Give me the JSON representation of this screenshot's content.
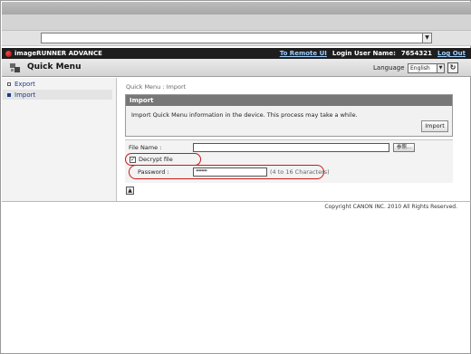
{
  "address_bar": {
    "dropdown_glyph": "▼"
  },
  "header": {
    "logo_text": "imageRUNNER ADVANCE",
    "remote_ui_link": "To Remote UI",
    "login_label": "Login User Name:",
    "user_name": "7654321",
    "logout_link": "Log Out"
  },
  "title_bar": {
    "title": "Quick Menu",
    "icon": "quick-menu-icon",
    "language_label": "Language",
    "language_value": "English",
    "refresh_icon": "refresh-icon"
  },
  "sidebar": {
    "items": [
      {
        "label": "Export",
        "active": false
      },
      {
        "label": "Import",
        "active": true
      }
    ]
  },
  "main": {
    "breadcrumb": "Quick Menu : Import",
    "panel_title": "Import",
    "panel_desc": "Import Quick Menu information in the device. This process may take a while.",
    "import_button": "Import",
    "file_name_label": "File Name :",
    "browse_button": "参照...",
    "decrypt_label": "Decrypt file",
    "decrypt_checked": true,
    "password_label": "Password :",
    "password_value": "********",
    "password_hint": "(4 to 16 Characters)"
  },
  "footer": {
    "copyright": "Copyright CANON INC. 2010 All Rights Reserved."
  },
  "colors": {
    "annotation_ring": "#c81a1a",
    "header_bg": "#1e1e1e",
    "link": "#9fd0ff"
  }
}
